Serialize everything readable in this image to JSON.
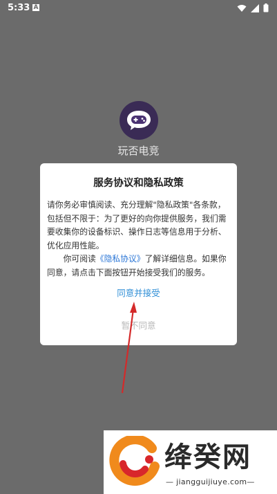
{
  "status_bar": {
    "time": "5:33",
    "a_icon": "A"
  },
  "app": {
    "name": "玩否电竞"
  },
  "dialog": {
    "title": "服务协议和隐私政策",
    "paragraph1": "请你务必审慎阅读、充分理解\"隐私政策\"各条款，包括但不限于：为了更好的向你提供服务，我们需要收集你的设备标识、操作日志等信息用于分析、优化应用性能。",
    "p2_prefix": "你可阅读",
    "p2_link": "《隐私协议》",
    "p2_suffix": "了解详细信息。如果你同意，请点击下面按钮开始接受我们的服务。",
    "agree_label": "同意并接受",
    "decline_label": "暂不同意"
  },
  "watermark": {
    "title": "绛癸网",
    "url": "jiangguijiuye.com"
  },
  "colors": {
    "overlay": "#6b6b6b",
    "link": "#2b76d6",
    "agree": "#2e8ed6",
    "arrow": "#d42a2a"
  }
}
